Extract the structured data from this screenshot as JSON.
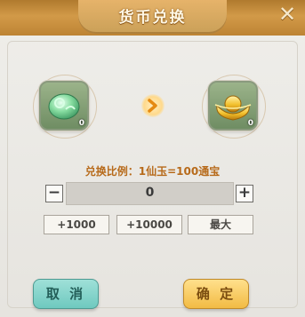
{
  "dialog": {
    "title": "货币兑换"
  },
  "exchange": {
    "source_item": {
      "icon": "jade-gem-icon",
      "count": "0"
    },
    "target_item": {
      "icon": "gold-ingot-icon",
      "count": "0"
    },
    "ratio_text": "兑换比例：1仙玉=100通宝"
  },
  "quantity": {
    "value": "0",
    "minus_label": "−",
    "plus_label": "+"
  },
  "quick_buttons": [
    "+1000",
    "+10000",
    "最大"
  ],
  "actions": {
    "cancel_label": "取 消",
    "confirm_label": "确 定"
  },
  "colors": {
    "header": "#c98f3e",
    "ratio_text": "#b76a1a",
    "cancel_bg": "#7fd0c6",
    "confirm_bg": "#f5c451"
  }
}
